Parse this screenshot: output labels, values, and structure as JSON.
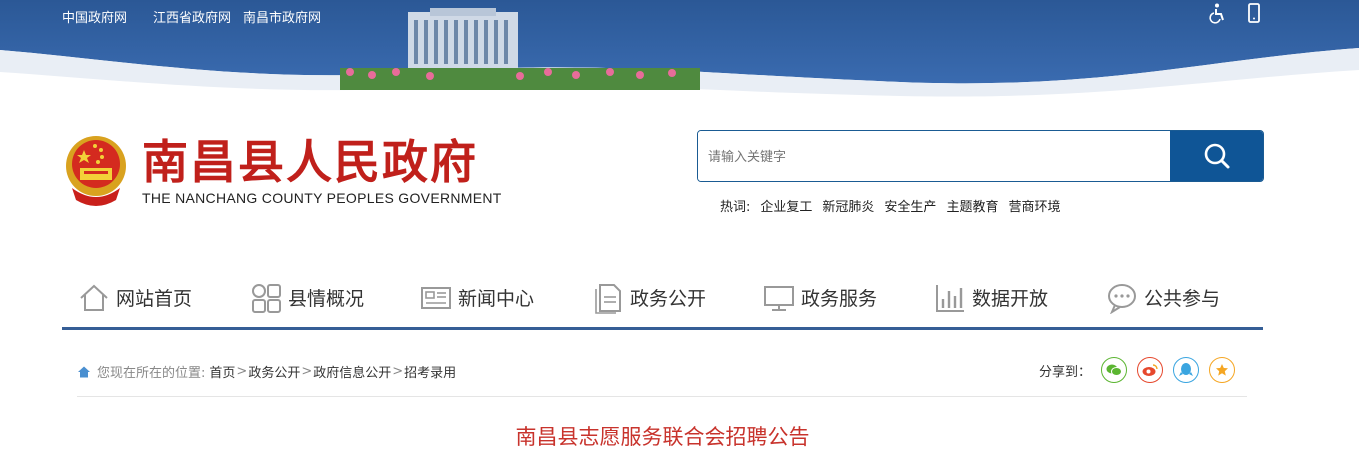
{
  "top_links": [
    "中国政府网",
    "江西省政府网",
    "南昌市政府网"
  ],
  "top_icons": [
    "accessibility-icon",
    "mobile-icon"
  ],
  "logo": {
    "title": "南昌县人民政府",
    "subtitle": "THE NANCHANG COUNTY PEOPLES GOVERNMENT",
    "emblem": "national-emblem"
  },
  "search": {
    "placeholder": "请输入关键字",
    "button_icon": "search-icon"
  },
  "hot_words": {
    "label": "热词:",
    "items": [
      "企业复工",
      "新冠肺炎",
      "安全生产",
      "主题教育",
      "营商环境"
    ]
  },
  "nav": [
    {
      "label": "网站首页",
      "icon": "home-icon"
    },
    {
      "label": "县情概况",
      "icon": "grid-icon"
    },
    {
      "label": "新闻中心",
      "icon": "news-icon"
    },
    {
      "label": "政务公开",
      "icon": "document-icon"
    },
    {
      "label": "政务服务",
      "icon": "monitor-icon"
    },
    {
      "label": "数据开放",
      "icon": "chart-icon"
    },
    {
      "label": "公共参与",
      "icon": "chat-icon"
    }
  ],
  "breadcrumb": {
    "prefix": "您现在所在的位置:",
    "items": [
      "首页",
      "政务公开",
      "政府信息公开",
      "招考录用"
    ],
    "separator": ">"
  },
  "share": {
    "label": "分享到：",
    "targets": [
      {
        "name": "wechat-icon",
        "color": "#5bb531"
      },
      {
        "name": "weibo-icon",
        "color": "#e6482d"
      },
      {
        "name": "qq-icon",
        "color": "#3aa5e0"
      },
      {
        "name": "favorite-icon",
        "color": "#f5a623"
      }
    ]
  },
  "article": {
    "title": "南昌县志愿服务联合会招聘公告"
  },
  "colors": {
    "banner_blue": "#2c5a9c",
    "brand_red": "#c0201b",
    "nav_underline": "#355e96",
    "search_button": "#0f5596",
    "title_red": "#c8332c"
  }
}
